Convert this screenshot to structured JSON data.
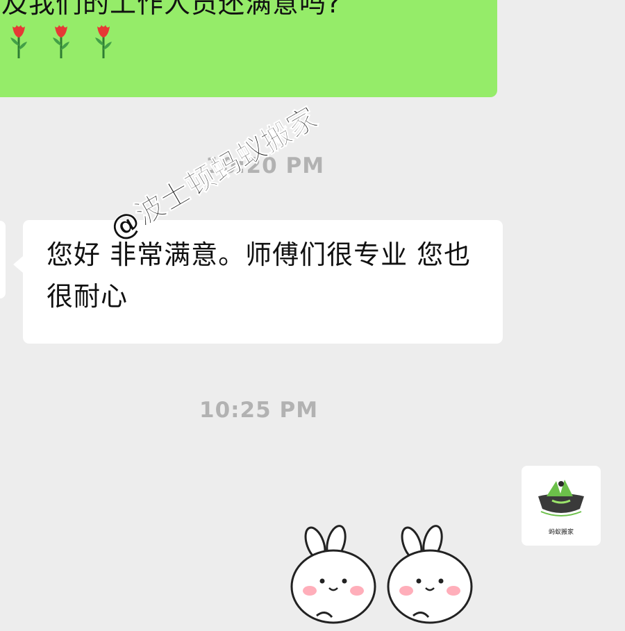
{
  "messages": {
    "sent_text": "及我们的工作人员还满意吗?",
    "sent_emoji": [
      "rose-emoji",
      "rose-emoji",
      "rose-emoji"
    ],
    "timestamp_1": "10:20 PM",
    "received_text": "您好 非常满意。师傅们很专业 您也很耐心",
    "timestamp_2": "10:25 PM"
  },
  "watermark": "@波士顿蚂蚁搬家",
  "avatar_right": {
    "caption": "蚂蚁搬家",
    "icon": "ant-moving-logo-icon"
  },
  "sticker": {
    "icon": "bunny-sticker",
    "count": 2
  },
  "colors": {
    "background": "#ededed",
    "sent_bubble": "#95ec69",
    "received_bubble": "#ffffff",
    "timestamp": "#b2b2b2"
  }
}
